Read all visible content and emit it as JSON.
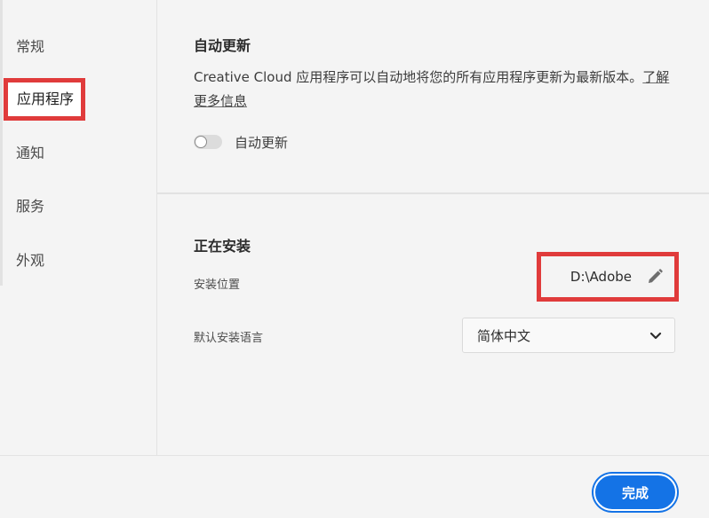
{
  "sidebar": {
    "items": [
      {
        "label": "常规"
      },
      {
        "label": "应用程序",
        "selected": true
      },
      {
        "label": "通知"
      },
      {
        "label": "服务"
      },
      {
        "label": "外观"
      }
    ]
  },
  "auto_update": {
    "title": "自动更新",
    "description": "Creative Cloud 应用程序可以自动地将您的所有应用程序更新为最新版本。",
    "learn_more": "了解更多信息",
    "toggle_label": "自动更新",
    "toggle_on": false
  },
  "installing": {
    "title": "正在安装",
    "location_label": "安装位置",
    "location_value": "D:\\Adobe",
    "language_label": "默认安装语言",
    "language_value": "简体中文"
  },
  "footer": {
    "done_label": "完成"
  },
  "colors": {
    "accent": "#1473e6",
    "highlight_border": "#e03b3b"
  },
  "icons": {
    "edit": "pencil-icon",
    "dropdown": "chevron-down-icon"
  }
}
